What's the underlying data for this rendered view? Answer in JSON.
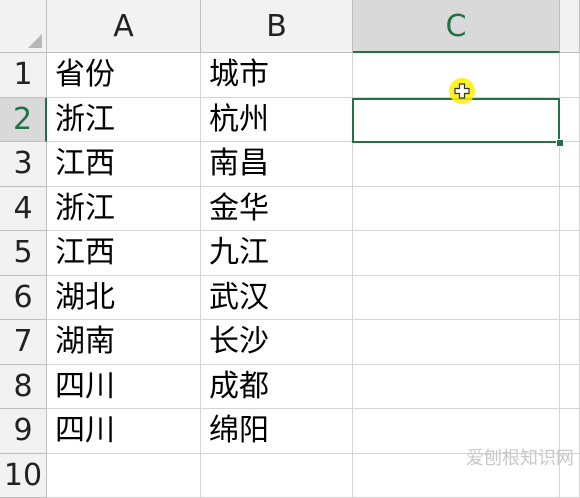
{
  "columns": [
    "A",
    "B",
    "C"
  ],
  "rows": [
    {
      "num": "1",
      "a": "省份",
      "b": "城市",
      "c": ""
    },
    {
      "num": "2",
      "a": "浙江",
      "b": "杭州",
      "c": ""
    },
    {
      "num": "3",
      "a": "江西",
      "b": "南昌",
      "c": ""
    },
    {
      "num": "4",
      "a": "浙江",
      "b": "金华",
      "c": ""
    },
    {
      "num": "5",
      "a": "江西",
      "b": "九江",
      "c": ""
    },
    {
      "num": "6",
      "a": "湖北",
      "b": "武汉",
      "c": ""
    },
    {
      "num": "7",
      "a": "湖南",
      "b": "长沙",
      "c": ""
    },
    {
      "num": "8",
      "a": "四川",
      "b": "成都",
      "c": ""
    },
    {
      "num": "9",
      "a": "四川",
      "b": "绵阳",
      "c": ""
    },
    {
      "num": "10",
      "a": "",
      "b": "",
      "c": ""
    }
  ],
  "selected_cell": "C2",
  "watermark": "爱刨根知识网",
  "colors": {
    "accent": "#217346",
    "header_bg": "#f2f2f2",
    "cursor": "#fff000"
  }
}
